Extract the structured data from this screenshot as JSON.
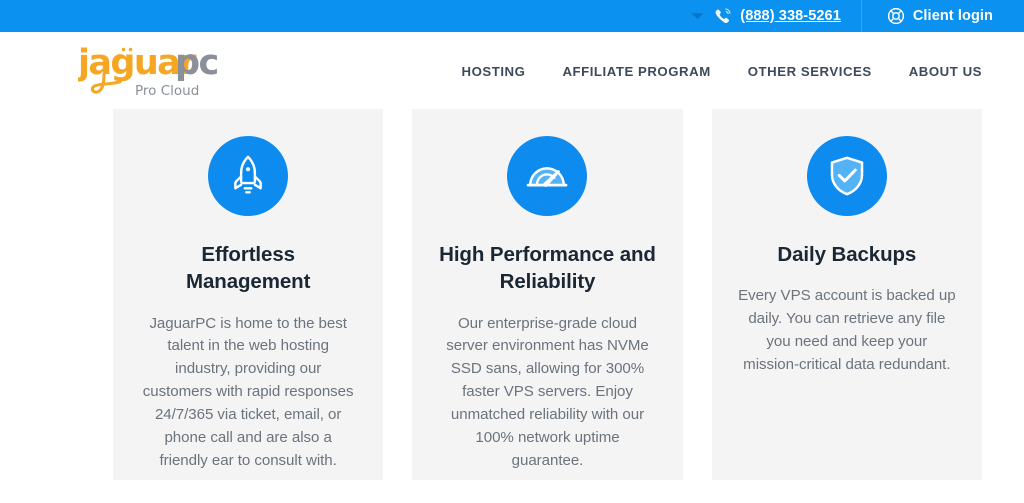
{
  "topbar": {
    "dropdown_icon": "chevron-down-icon",
    "phone_icon": "phone-ringing-icon",
    "phone": "(888) 338-5261",
    "support_icon": "lifebuoy-icon",
    "client_login": "Client login"
  },
  "logo": {
    "primary": "jaguar",
    "secondary": "pc",
    "tagline": "Pro Cloud",
    "primary_color": "#f5a623",
    "secondary_color": "#8a8f98",
    "tagline_color": "#8a8f98"
  },
  "nav": {
    "items": [
      {
        "label": "HOSTING",
        "name": "nav-item-hosting"
      },
      {
        "label": "AFFILIATE PROGRAM",
        "name": "nav-item-affiliate-program"
      },
      {
        "label": "OTHER SERVICES",
        "name": "nav-item-other-services"
      },
      {
        "label": "ABOUT US",
        "name": "nav-item-about-us"
      }
    ]
  },
  "features": {
    "cards": [
      {
        "icon": "rocket-icon",
        "title": "Effortless Management",
        "body": "JaguarPC is home to the best talent in the web hosting industry, providing our customers with rapid responses 24/7/365 via ticket, email, or phone call and are also a friendly ear to consult with."
      },
      {
        "icon": "speedometer-icon",
        "title": "High Performance and Reliability",
        "body": "Our enterprise-grade cloud server environment has NVMe SSD sans, allowing for 300% faster VPS servers. Enjoy unmatched reliability with our 100% network uptime guarantee."
      },
      {
        "icon": "shield-check-icon",
        "title": "Daily Backups",
        "body": "Every VPS account is backed up daily. You can retrieve any file you need and keep your mission-critical data redundant."
      }
    ]
  },
  "colors": {
    "topbar_blue": "#0b91f0",
    "icon_blue": "#0d8bee",
    "card_background": "#f4f4f5",
    "heading": "#1b2733",
    "body_text": "#6b737c",
    "nav_text": "#3d4a5c"
  }
}
